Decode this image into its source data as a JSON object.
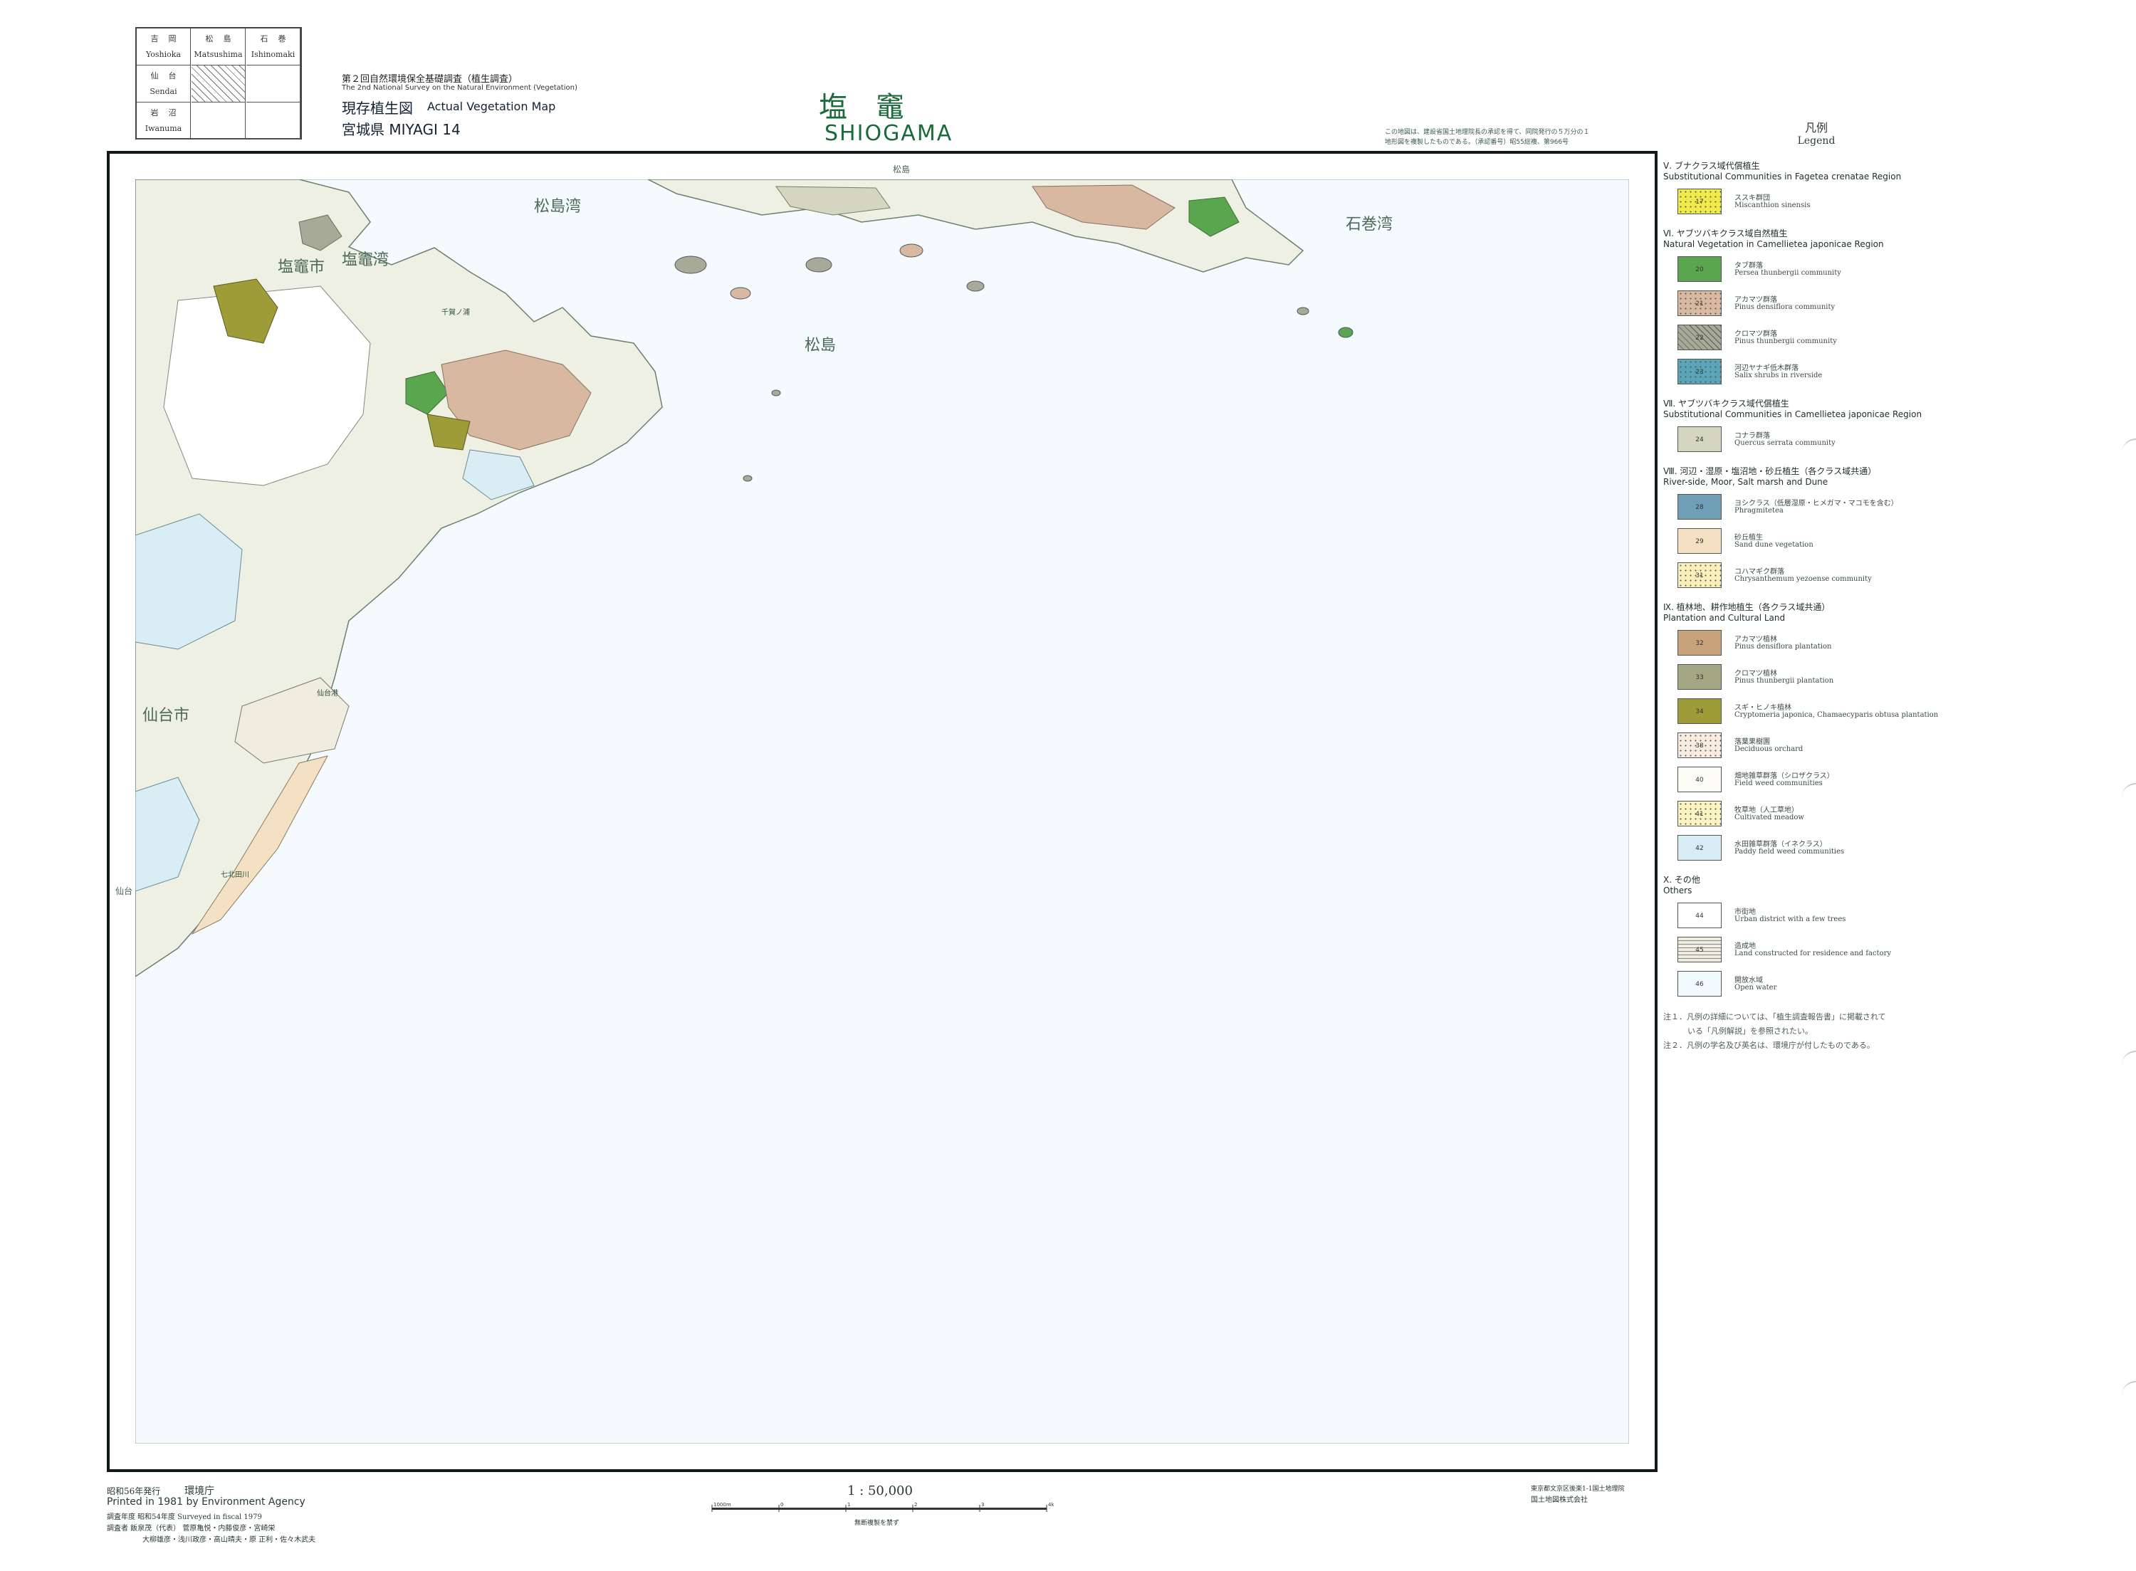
{
  "index_map": {
    "cells": [
      {
        "jp": "吉岡",
        "en": "Yoshioka"
      },
      {
        "jp": "松島",
        "en": "Matsushima"
      },
      {
        "jp": "石巻",
        "en": "Ishinomaki"
      },
      {
        "jp": "仙台",
        "en": "Sendai"
      },
      {
        "jp": "",
        "en": ""
      },
      {
        "jp": "",
        "en": ""
      },
      {
        "jp": "岩沼",
        "en": "Iwanuma"
      },
      {
        "jp": "",
        "en": ""
      },
      {
        "jp": "",
        "en": ""
      }
    ]
  },
  "header": {
    "survey_jp": "第２回自然環境保全基礎調査（植生調査）",
    "survey_en": "The 2nd National Survey on the Natural Environment (Vegetation)",
    "map_type_jp": "現存植生図",
    "map_type_en": "Actual Vegetation Map",
    "prefecture": "宮城県 MIYAGI 14",
    "title_jp": "塩竈",
    "title_en": "SHIOGAMA",
    "note_line1": "この地図は、建設省国土地理院長の承認を得て、同院発行の５万分の１",
    "note_line2": "地形図を複製したものである。（承認番号）昭55総複、第966号"
  },
  "map_labels": {
    "top_margin": "松島",
    "matsushima_bay": "松島湾",
    "ishinomaki_bay": "石巻湾",
    "shiogama_city": "塩竈市",
    "matsushima_islands": "松島",
    "sendai_city": "仙台市",
    "sendai_port": "仙台港",
    "shichigahama": "七北田川",
    "shiogama_bay": "塩竈湾",
    "port_label": "千賀ノ浦",
    "side_label": "仙台"
  },
  "legend": {
    "title_jp": "凡例",
    "title_en": "Legend",
    "regions": [
      {
        "jp": "Ⅴ. ブナクラス域代償植生",
        "en": "Substitutional Communities in Fagetea crenatae Region",
        "items": [
          {
            "code": "17",
            "color": "#f0ea4a",
            "pattern": "dots",
            "jp": "ススキ群団",
            "en": "Miscanthion sinensis"
          }
        ]
      },
      {
        "jp": "Ⅵ. ヤブツバキクラス域自然植生",
        "en": "Natural Vegetation in Camellietea japonicae Region",
        "items": [
          {
            "code": "20",
            "color": "#5aa64e",
            "pattern": "solid",
            "jp": "タブ群落",
            "en": "Persea thunbergii community"
          },
          {
            "code": "21",
            "color": "#d8b8a0",
            "pattern": "dots",
            "jp": "アカマツ群落",
            "en": "Pinus densiflora community"
          },
          {
            "code": "22",
            "color": "#a8aa98",
            "pattern": "cross",
            "jp": "クロマツ群落",
            "en": "Pinus thunbergii community"
          },
          {
            "code": "23",
            "color": "#5aa6b8",
            "pattern": "dots",
            "jp": "河辺ヤナギ低木群落",
            "en": "Salix shrubs in riverside"
          }
        ]
      },
      {
        "jp": "Ⅶ. ヤブツバキクラス域代償植生",
        "en": "Substitutional Communities in Camellietea japonicae Region",
        "items": [
          {
            "code": "24",
            "color": "#d4d6c0",
            "pattern": "solid",
            "jp": "コナラ群落",
            "en": "Quercus serrata community"
          }
        ]
      },
      {
        "jp": "Ⅷ. 河辺・湿原・塩沼地・砂丘植生（各クラス域共通）",
        "en": "River-side, Moor, Salt marsh and Dune",
        "items": [
          {
            "code": "28",
            "color": "#6f9fb6",
            "pattern": "solid",
            "jp": "ヨシクラス（低層湿原・ヒメガマ・マコモを含む）",
            "en": "Phragmitetea"
          },
          {
            "code": "29",
            "color": "#f4e0c2",
            "pattern": "solid",
            "jp": "砂丘植生",
            "en": "Sand dune vegetation"
          },
          {
            "code": "31",
            "color": "#f8f0b8",
            "pattern": "dots",
            "jp": "コハマギク群落",
            "en": "Chrysanthemum yezoense community"
          }
        ]
      },
      {
        "jp": "Ⅸ. 植林地、耕作地植生（各クラス域共通）",
        "en": "Plantation and Cultural Land",
        "items": [
          {
            "code": "32",
            "color": "#c8a27a",
            "pattern": "solid",
            "jp": "アカマツ植林",
            "en": "Pinus densiflora plantation"
          },
          {
            "code": "33",
            "color": "#a4a684",
            "pattern": "solid",
            "jp": "クロマツ植林",
            "en": "Pinus thunbergii plantation"
          },
          {
            "code": "34",
            "color": "#9e9c38",
            "pattern": "solid",
            "jp": "スギ・ヒノキ植林",
            "en": "Cryptomeria japonica, Chamaecyparis obtusa plantation"
          },
          {
            "code": "38",
            "color": "#f8ece0",
            "pattern": "dots",
            "jp": "落葉果樹園",
            "en": "Deciduous orchard"
          },
          {
            "code": "40",
            "color": "#fcfcf4",
            "pattern": "solid",
            "jp": "畑地雑草群落（シロザクラス）",
            "en": "Field weed communities"
          },
          {
            "code": "41",
            "color": "#fcf4c0",
            "pattern": "dots",
            "jp": "牧草地（人工草地）",
            "en": "Cultivated meadow"
          },
          {
            "code": "42",
            "color": "#d8eef4",
            "pattern": "solid",
            "jp": "水田雑草群落（イネクラス）",
            "en": "Paddy field weed communities"
          }
        ]
      },
      {
        "jp": "Ⅹ. その他",
        "en": "Others",
        "items": [
          {
            "code": "44",
            "color": "#ffffff",
            "pattern": "solid",
            "jp": "市街地",
            "en": "Urban district with a few trees"
          },
          {
            "code": "45",
            "color": "#f0ece0",
            "pattern": "lines",
            "jp": "造成地",
            "en": "Land constructed for residence and factory"
          },
          {
            "code": "46",
            "color": "#f2fafd",
            "pattern": "solid",
            "jp": "開放水域",
            "en": "Open water"
          }
        ]
      }
    ],
    "footnotes": [
      "注１．凡例の詳細については、「植生調査報告書」に掲載されて",
      "いる「凡例解説」を参照されたい。",
      "注２．凡例の学名及び英名は、環境庁が付したものである。"
    ]
  },
  "footer": {
    "issued_jp": "昭和56年発行",
    "agency_jp": "環境庁",
    "printed": "Printed in 1981 by Environment Agency",
    "surveyed": "調査年度 昭和54年度 Surveyed in fiscal 1979",
    "investigators1": "調査者 飯泉茂（代表） 菅原亀悦・内藤俊彦・宮崎栄",
    "investigators2": "大柳雄彦・浅川政彦・高山晴夫・原 正利・佐々木武夫",
    "scale": "1 : 50,000",
    "scale_note": "無断複製を禁ず",
    "scale_ticks": [
      "1000m",
      "0",
      "1",
      "2",
      "3",
      "4km"
    ],
    "publisher1": "東京都文京区後楽1-1国土地理院",
    "publisher2": "国土地図株式会社"
  }
}
